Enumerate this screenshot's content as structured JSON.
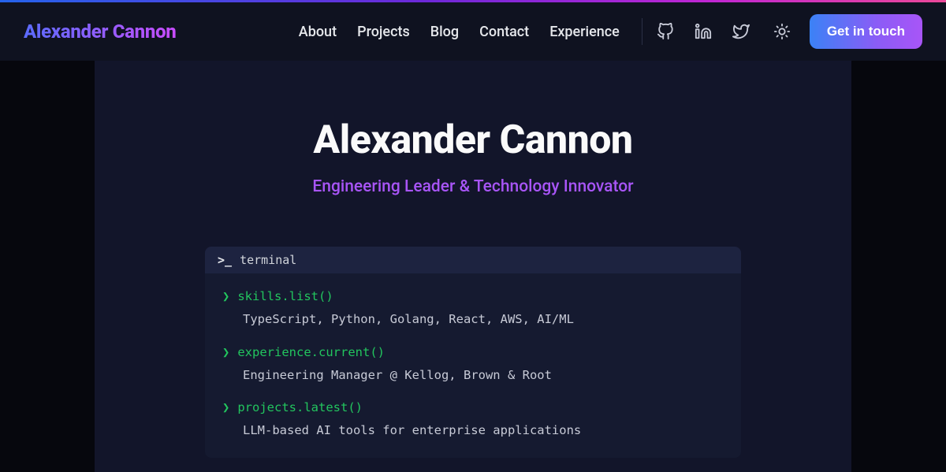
{
  "header": {
    "brand": "Alexander Cannon",
    "nav": {
      "about": "About",
      "projects": "Projects",
      "blog": "Blog",
      "contact": "Contact",
      "experience": "Experience"
    },
    "cta": "Get in touch"
  },
  "hero": {
    "title": "Alexander Cannon",
    "subtitle": "Engineering Leader & Technology Innovator"
  },
  "terminal": {
    "label": "terminal",
    "rows": [
      {
        "cmd": "skills.list()",
        "out": "TypeScript, Python, Golang, React, AWS, AI/ML"
      },
      {
        "cmd": "experience.current()",
        "out": "Engineering Manager @ Kellog, Brown & Root"
      },
      {
        "cmd": "projects.latest()",
        "out": "LLM-based AI tools for enterprise applications"
      }
    ]
  }
}
